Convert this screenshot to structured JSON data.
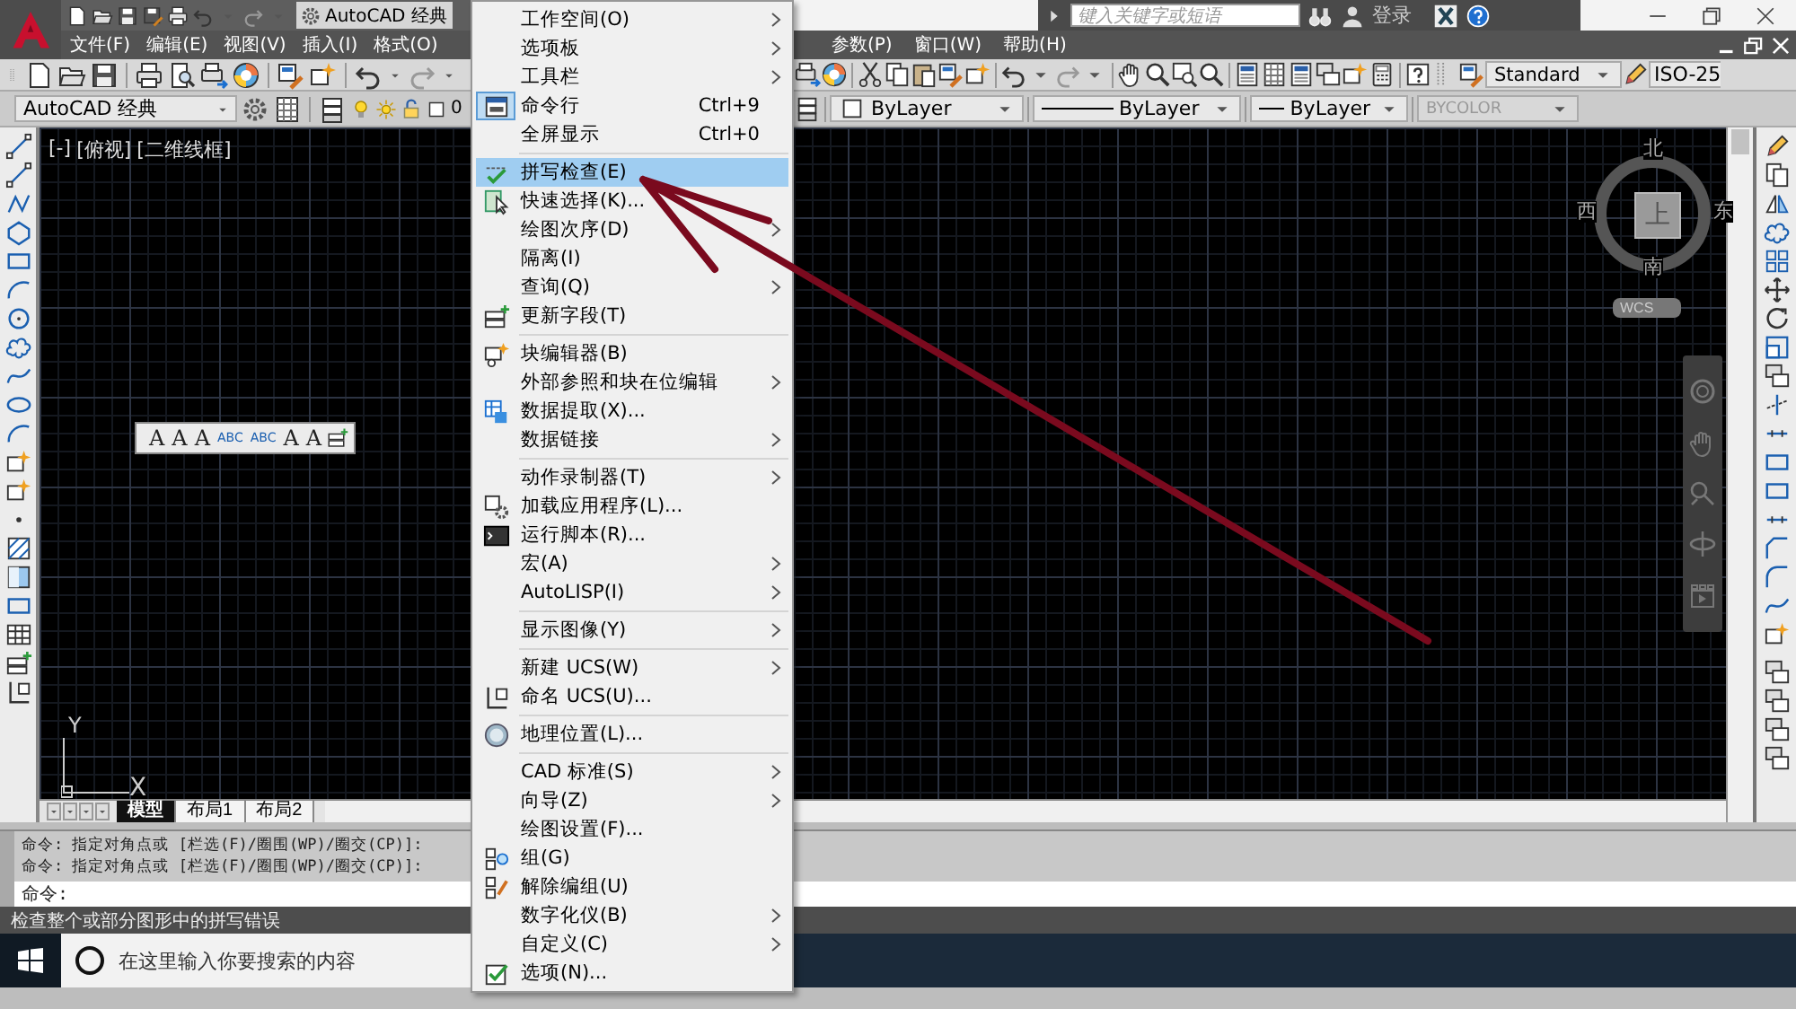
{
  "quick_access": {
    "workspace": "AutoCAD 经典"
  },
  "search_bar": {
    "placeholder": "键入关键字或短语",
    "login": "登录"
  },
  "menubar": {
    "items_left": [
      "文件(F)",
      "编辑(E)",
      "视图(V)",
      "插入(I)",
      "格式(O)"
    ],
    "items_right": [
      "参数(P)",
      "窗口(W)",
      "帮助(H)"
    ]
  },
  "styles_toolbar": {
    "text_style": "Standard",
    "dim_style": "ISO-25"
  },
  "layers_toolbar": {
    "workspace": "AutoCAD 经典",
    "layer": "0"
  },
  "properties_toolbar": {
    "color_control": "ByLayer",
    "linetype": "ByLayer",
    "lineweight": "ByLayer",
    "plot_style": "BYCOLOR",
    "plot_style_disabled": true
  },
  "viewport": {
    "controls": [
      "[-]",
      "[俯视]",
      "[二维线框]"
    ]
  },
  "viewcube": {
    "north": "北",
    "west": "西",
    "face": "上",
    "east": "东",
    "south": "南",
    "coords": "WCS"
  },
  "text_toolbar": {
    "buttons": [
      "A",
      "A",
      "A",
      "ABC",
      "ABC",
      "A",
      "A"
    ]
  },
  "ucs_icon": {
    "y": "Y",
    "x": "X"
  },
  "layout_tabs": [
    {
      "label": "模型",
      "selected": true
    },
    {
      "label": "布局1",
      "selected": false
    },
    {
      "label": "布局2",
      "selected": false
    }
  ],
  "command_history": [
    "命令: 指定对角点或 [栏选(F)/圈围(WP)/圈交(CP)]:",
    "命令: 指定对角点或 [栏选(F)/圈围(WP)/圈交(CP)]:"
  ],
  "command_prompt": "命令:",
  "status_bar": "检查整个或部分图形中的拼写错误",
  "taskbar": {
    "search_placeholder": "在这里输入你要搜索的内容"
  },
  "context_menu": {
    "groups": [
      [
        {
          "label": "工作空间(O)",
          "submenu": true,
          "selected": false,
          "checked": false
        },
        {
          "label": "选项板",
          "submenu": true,
          "selected": false,
          "checked": false
        },
        {
          "label": "工具栏",
          "submenu": true,
          "selected": false,
          "checked": false
        },
        {
          "label": "命令行",
          "shortcut": "Ctrl+9",
          "submenu": false,
          "selected": false,
          "checked": true
        },
        {
          "label": "全屏显示",
          "shortcut": "Ctrl+0",
          "submenu": false,
          "selected": false,
          "checked": false
        }
      ],
      [
        {
          "label": "拼写检查(E)",
          "submenu": false,
          "selected": true,
          "checked": false
        },
        {
          "label": "快速选择(K)...",
          "submenu": false,
          "selected": false,
          "checked": false
        },
        {
          "label": "绘图次序(D)",
          "submenu": true,
          "selected": false,
          "checked": false
        },
        {
          "label": "隔离(I)",
          "submenu": false,
          "selected": false,
          "checked": false
        },
        {
          "label": "查询(Q)",
          "submenu": true,
          "selected": false,
          "checked": false
        },
        {
          "label": "更新字段(T)",
          "submenu": false,
          "selected": false,
          "checked": false
        }
      ],
      [
        {
          "label": "块编辑器(B)",
          "submenu": false,
          "selected": false,
          "checked": false
        },
        {
          "label": "外部参照和块在位编辑",
          "submenu": true,
          "selected": false,
          "checked": false
        },
        {
          "label": "数据提取(X)...",
          "submenu": false,
          "selected": false,
          "checked": false
        },
        {
          "label": "数据链接",
          "submenu": true,
          "selected": false,
          "checked": false
        }
      ],
      [
        {
          "label": "动作录制器(T)",
          "submenu": true,
          "selected": false,
          "checked": false
        },
        {
          "label": "加载应用程序(L)...",
          "submenu": false,
          "selected": false,
          "checked": false
        },
        {
          "label": "运行脚本(R)...",
          "submenu": false,
          "selected": false,
          "checked": false
        },
        {
          "label": "宏(A)",
          "submenu": true,
          "selected": false,
          "checked": false
        },
        {
          "label": "AutoLISP(I)",
          "submenu": true,
          "selected": false,
          "checked": false
        }
      ],
      [
        {
          "label": "显示图像(Y)",
          "submenu": true,
          "selected": false,
          "checked": false
        }
      ],
      [
        {
          "label": "新建 UCS(W)",
          "submenu": true,
          "selected": false,
          "checked": false
        },
        {
          "label": "命名 UCS(U)...",
          "submenu": false,
          "selected": false,
          "checked": false
        }
      ],
      [
        {
          "label": "地理位置(L)...",
          "submenu": false,
          "selected": false,
          "checked": false
        }
      ],
      [
        {
          "label": "CAD 标准(S)",
          "submenu": true,
          "selected": false,
          "checked": false
        },
        {
          "label": "向导(Z)",
          "submenu": true,
          "selected": false,
          "checked": false
        },
        {
          "label": "绘图设置(F)...",
          "submenu": false,
          "selected": false,
          "checked": false
        },
        {
          "label": "组(G)",
          "submenu": false,
          "selected": false,
          "checked": false
        },
        {
          "label": "解除编组(U)",
          "submenu": false,
          "selected": false,
          "checked": false
        },
        {
          "label": "数字化仪(B)",
          "submenu": true,
          "selected": false,
          "checked": false
        },
        {
          "label": "自定义(C)",
          "submenu": true,
          "selected": false,
          "checked": false
        },
        {
          "label": "选项(N)...",
          "submenu": false,
          "selected": false,
          "checked": false
        }
      ]
    ]
  }
}
